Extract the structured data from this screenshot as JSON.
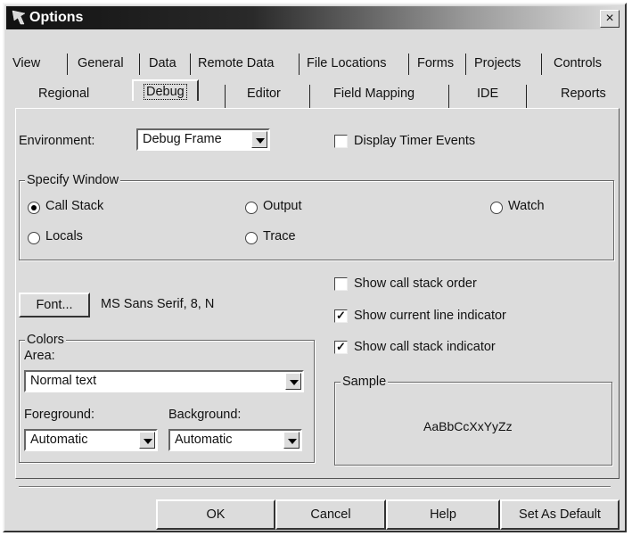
{
  "window": {
    "title": "Options",
    "close_glyph": "×"
  },
  "tabs_row1": [
    "View",
    "General",
    "Data",
    "Remote Data",
    "File Locations",
    "Forms",
    "Projects",
    "Controls"
  ],
  "tabs_row2": [
    "Regional",
    "Debug",
    "Editor",
    "Field Mapping",
    "IDE",
    "Reports"
  ],
  "active_tab": "Debug",
  "environment": {
    "label": "Environment:",
    "value": "Debug Frame"
  },
  "display_timer": {
    "label": "Display Timer Events",
    "checked": false
  },
  "specify_window": {
    "title": "Specify Window",
    "options": [
      "Call Stack",
      "Output",
      "Watch",
      "Locals",
      "Trace"
    ],
    "selected": "Call Stack"
  },
  "font": {
    "button_label": "Font...",
    "value": "MS Sans Serif, 8, N"
  },
  "colors": {
    "title": "Colors",
    "area_label": "Area:",
    "area_value": "Normal text",
    "foreground_label": "Foreground:",
    "foreground_value": "Automatic",
    "background_label": "Background:",
    "background_value": "Automatic"
  },
  "checkboxes": [
    {
      "label": "Show call stack order",
      "checked": false
    },
    {
      "label": "Show current line indicator",
      "checked": true
    },
    {
      "label": "Show call stack indicator",
      "checked": true
    }
  ],
  "sample": {
    "title": "Sample",
    "text": "AaBbCcXxYyZz"
  },
  "buttons": {
    "ok": "OK",
    "cancel": "Cancel",
    "help": "Help",
    "set_default": "Set As Default"
  },
  "check_glyph": "✓",
  "icons": [
    "app-icon",
    "close-icon",
    "dropdown-arrow-icon"
  ]
}
